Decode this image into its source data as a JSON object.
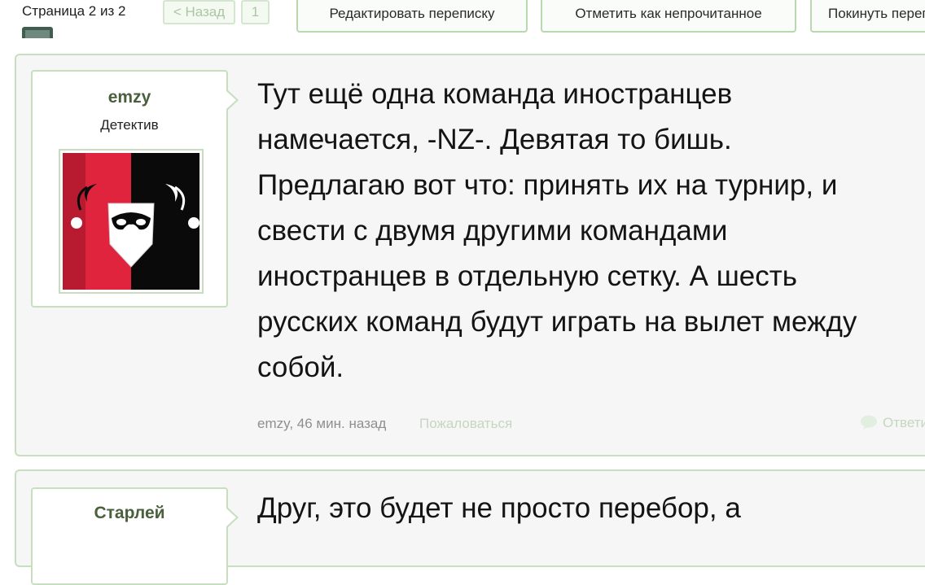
{
  "pager": {
    "label": "Страница 2 из 2",
    "prev": "< Назад",
    "page": "1"
  },
  "toolbar": {
    "edit": "Редактировать переписку",
    "unread": "Отметить как непрочитанное",
    "leave": "Покинуть переписку"
  },
  "posts": [
    {
      "username": "emzy",
      "usertitle": "Детектив",
      "text": "Тут ещё одна команда иностранцев\nнамечается, -NZ-. Девятая то бишь.\nПредлагаю вот что: принять их на турнир, и\nсвести с двумя другими командами\nиностранцев в отдельную сетку. А шесть\nрусских команд будут играть на вылет между\nсобой.",
      "meta": "emzy, 46 мин. назад",
      "report": "Пожаловаться",
      "reply": "Ответить",
      "avatar_icon": "harlequin-mask-icon"
    },
    {
      "username": "Старлей",
      "text": "Друг, это будет не просто перебор, а"
    }
  ],
  "colors": {
    "accent": "#4a5f3c",
    "border": "#c7dfbf",
    "avatar_red": "#e0243d",
    "avatar_black": "#0a0a0a"
  }
}
